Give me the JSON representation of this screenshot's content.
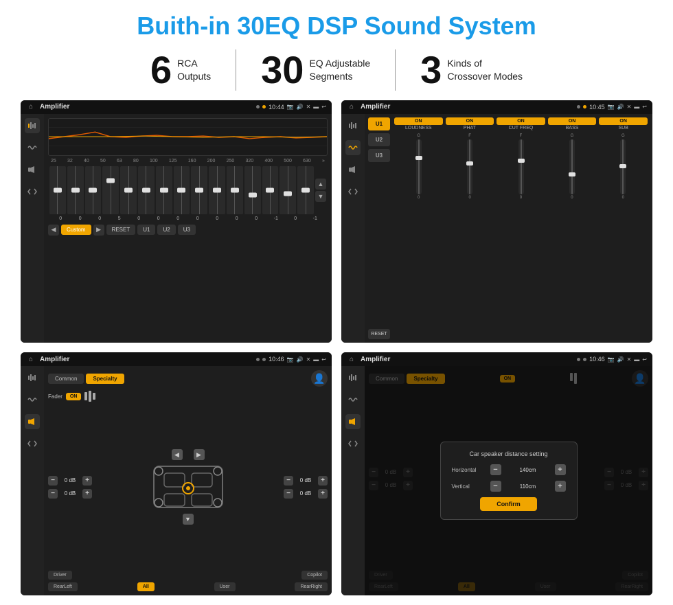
{
  "page": {
    "title": "Buith-in 30EQ DSP Sound System"
  },
  "stats": [
    {
      "number": "6",
      "desc_line1": "RCA",
      "desc_line2": "Outputs"
    },
    {
      "number": "30",
      "desc_line1": "EQ Adjustable",
      "desc_line2": "Segments"
    },
    {
      "number": "3",
      "desc_line1": "Kinds of",
      "desc_line2": "Crossover Modes"
    }
  ],
  "screens": {
    "top_left": {
      "status": {
        "title": "Amplifier",
        "time": "10:44"
      },
      "eq_labels": [
        "25",
        "32",
        "40",
        "50",
        "63",
        "80",
        "100",
        "125",
        "160",
        "200",
        "250",
        "320",
        "400",
        "500",
        "630"
      ],
      "eq_values": [
        "0",
        "0",
        "0",
        "5",
        "0",
        "0",
        "0",
        "0",
        "0",
        "0",
        "0",
        "-1",
        "0",
        "-1"
      ],
      "preset": "Custom",
      "buttons": [
        "RESET",
        "U1",
        "U2",
        "U3"
      ]
    },
    "top_right": {
      "status": {
        "title": "Amplifier",
        "time": "10:45"
      },
      "modes": [
        "U1",
        "U2",
        "U3"
      ],
      "toggles": [
        "LOUDNESS",
        "PHAT",
        "CUT FREQ",
        "BASS",
        "SUB"
      ],
      "reset_label": "RESET"
    },
    "bottom_left": {
      "status": {
        "title": "Amplifier",
        "time": "10:46"
      },
      "tabs": [
        "Common",
        "Specialty"
      ],
      "fader_label": "Fader",
      "fader_on": "ON",
      "db_values": [
        "0 dB",
        "0 dB",
        "0 dB",
        "0 dB"
      ],
      "buttons": [
        "Driver",
        "Copilot",
        "RearLeft",
        "All",
        "User",
        "RearRight"
      ]
    },
    "bottom_right": {
      "status": {
        "title": "Amplifier",
        "time": "10:46"
      },
      "tabs": [
        "Common",
        "Specialty"
      ],
      "dialog": {
        "title": "Car speaker distance setting",
        "horizontal_label": "Horizontal",
        "horizontal_value": "140cm",
        "vertical_label": "Vertical",
        "vertical_value": "110cm",
        "confirm_label": "Confirm"
      },
      "db_values": [
        "0 dB",
        "0 dB"
      ],
      "buttons": [
        "Driver",
        "Copilot",
        "RearLeft",
        "All",
        "User",
        "RearRight"
      ]
    }
  }
}
